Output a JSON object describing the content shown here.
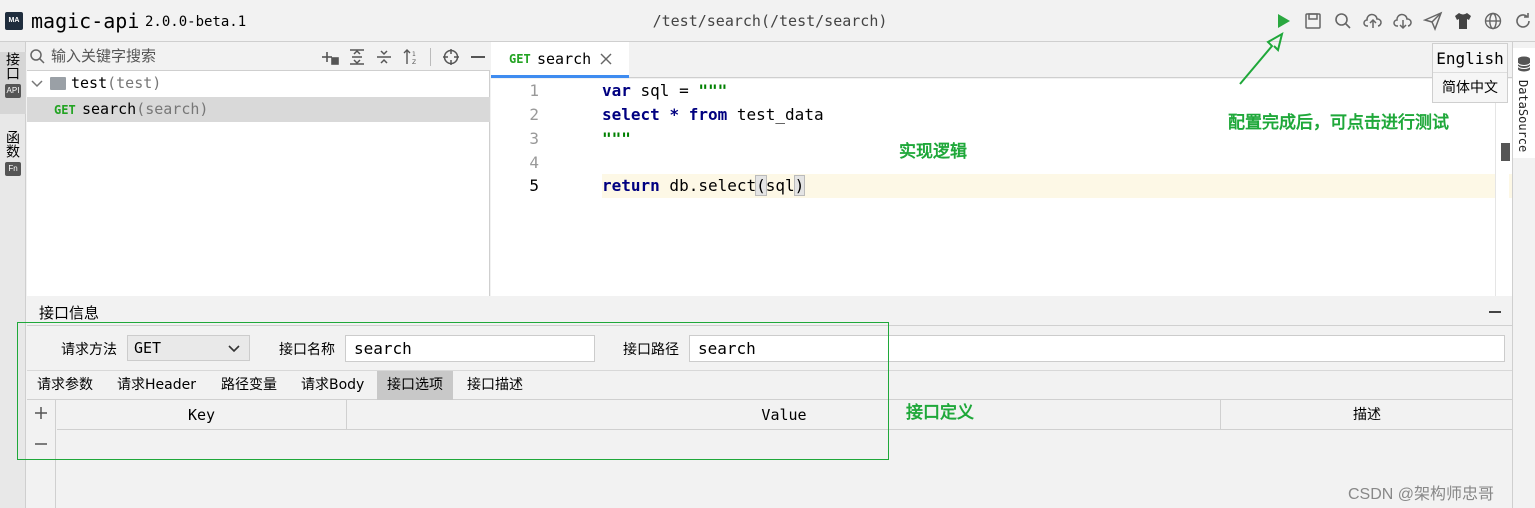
{
  "header": {
    "logo_text": "MA",
    "app_name": "magic-api",
    "version": "2.0.0-beta.1",
    "path": "/test/search(/test/search)",
    "toolbar_icons": [
      "run-icon",
      "save-icon",
      "search-icon",
      "upload-icon",
      "download-icon",
      "push-icon",
      "skin-icon",
      "language-icon",
      "refresh-icon"
    ]
  },
  "left_bar": {
    "api_tab": {
      "label": "接口",
      "badge": "API"
    },
    "func_tab": {
      "label": "函数",
      "badge": "Fn"
    }
  },
  "right_bar": {
    "datasource_label": "DataSource"
  },
  "tree": {
    "search_placeholder": "输入关键字搜索",
    "folder": {
      "name": "test",
      "paren": "(test)"
    },
    "api": {
      "method": "GET",
      "name": "search",
      "paren": "(search)"
    }
  },
  "editor": {
    "tab": {
      "method": "GET",
      "label": "search"
    },
    "line_numbers": [
      "1",
      "2",
      "3",
      "4",
      "5"
    ],
    "lines": [
      "var sql = \"\"\"",
      "select * from test_data",
      "\"\"\"",
      "",
      "return db.select(sql)"
    ]
  },
  "language_menu": {
    "english": "English",
    "chinese": "简体中文"
  },
  "annotations": {
    "run_hint": "配置完成后，可点击进行测试",
    "logic": "实现逻辑",
    "definition": "接口定义"
  },
  "bottom": {
    "title": "接口信息",
    "method_label": "请求方法",
    "method_value": "GET",
    "name_label": "接口名称",
    "name_value": "search",
    "path_label": "接口路径",
    "path_value": "search",
    "tabs": [
      "请求参数",
      "请求Header",
      "路径变量",
      "请求Body",
      "接口选项",
      "接口描述"
    ],
    "active_tab": "接口选项",
    "columns": [
      "Key",
      "Value",
      "描述"
    ]
  },
  "watermark": "CSDN @架构师忠哥",
  "colors": {
    "accent": "#3f8cf0",
    "get_method": "#22a322",
    "annotation": "#1fa83a",
    "run_icon": "#2aa840"
  }
}
